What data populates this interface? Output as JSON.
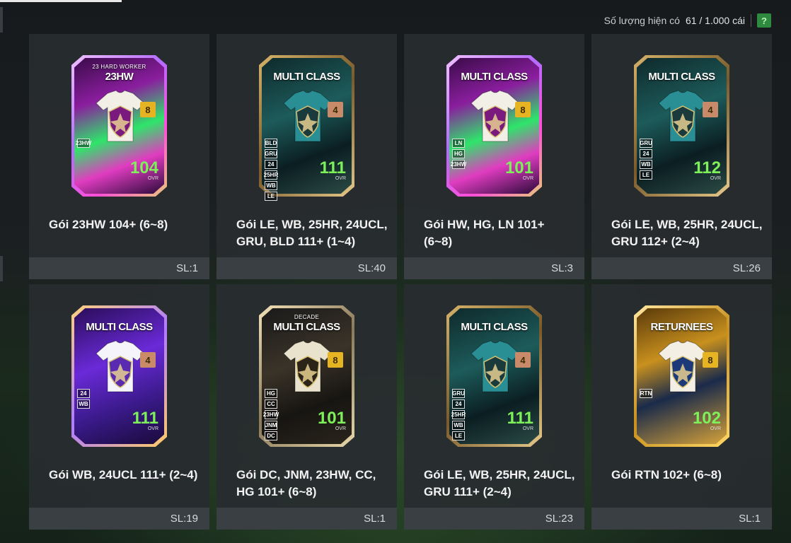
{
  "header": {
    "inventory_label": "Số lượng hiện có",
    "inventory_count": "61 / 1.000 cái",
    "help_label": "?"
  },
  "packs": [
    {
      "name": "Gói 23HW 104+ (6~8)",
      "qty": "SL:1",
      "subtitle": "23 HARD WORKER",
      "title": "23HW",
      "badge": "8",
      "ovr": "104",
      "theme": "hw",
      "tags": [
        "23HW"
      ]
    },
    {
      "name": "Gói LE, WB, 25HR, 24UCL, GRU, BLD 111+ (1~4)",
      "qty": "SL:40",
      "subtitle": "",
      "title": "MULTI CLASS",
      "badge": "4",
      "ovr": "111",
      "theme": "teal",
      "tags": [
        "BLD",
        "GRU",
        "24",
        "25HR",
        "WB",
        "LE"
      ]
    },
    {
      "name": "Gói HW, HG, LN 101+ (6~8)",
      "qty": "SL:3",
      "subtitle": "",
      "title": "MULTI CLASS",
      "badge": "8",
      "ovr": "101",
      "theme": "hw",
      "tags": [
        "LN",
        "HG",
        "23HW"
      ]
    },
    {
      "name": "Gói LE, WB, 25HR, 24UCL, GRU 112+ (2~4)",
      "qty": "SL:26",
      "subtitle": "",
      "title": "MULTI CLASS",
      "badge": "4",
      "ovr": "112",
      "theme": "teal",
      "tags": [
        "GRU",
        "24",
        "WB",
        "LE"
      ]
    },
    {
      "name": "Gói WB, 24UCL 111+ (2~4)",
      "qty": "SL:19",
      "subtitle": "",
      "title": "MULTI CLASS",
      "badge": "4",
      "ovr": "111",
      "theme": "purple",
      "tags": [
        "24",
        "WB"
      ]
    },
    {
      "name": "Gói DC, JNM, 23HW, CC, HG 101+ (6~8)",
      "qty": "SL:1",
      "subtitle": "DECADE",
      "title": "MULTI CLASS",
      "badge": "8",
      "ovr": "101",
      "theme": "decade",
      "tags": [
        "HG",
        "CC",
        "23HW",
        "JNM",
        "DC"
      ]
    },
    {
      "name": "Gói LE, WB, 25HR, 24UCL, GRU 111+ (2~4)",
      "qty": "SL:23",
      "subtitle": "",
      "title": "MULTI CLASS",
      "badge": "4",
      "ovr": "111",
      "theme": "teal",
      "tags": [
        "GRU",
        "24",
        "25HR",
        "WB",
        "LE"
      ]
    },
    {
      "name": "Gói RTN 102+ (6~8)",
      "qty": "SL:1",
      "subtitle": "",
      "title": "RETURNEES",
      "badge": "8",
      "ovr": "102",
      "theme": "gold",
      "tags": [
        "RTN"
      ]
    }
  ],
  "ovr_label": "OVR",
  "colors": {
    "accent": "#2d8a3e",
    "ovr_green": "#7ef05a",
    "badge_gold": "#e6b422",
    "badge_copper": "#c98a6a"
  }
}
